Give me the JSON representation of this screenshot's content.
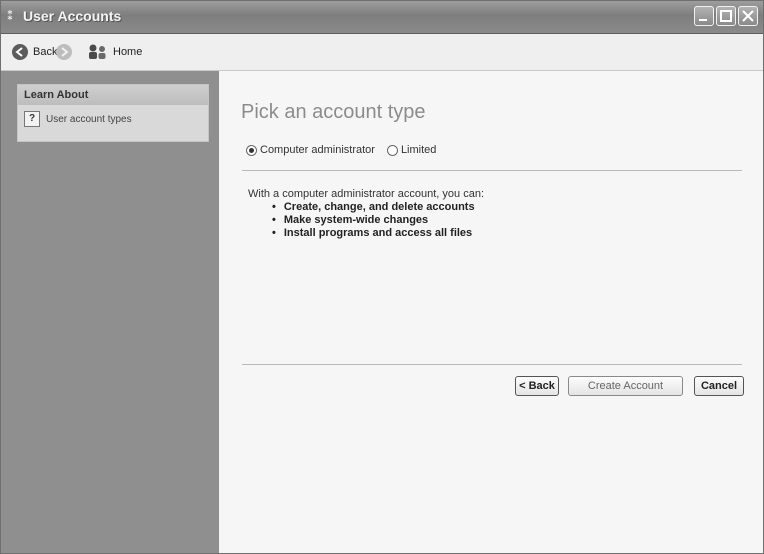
{
  "window": {
    "title": "User Accounts"
  },
  "toolbar": {
    "back_label": "Back",
    "home_label": "Home"
  },
  "sidebar": {
    "section_title": "Learn About",
    "items": [
      {
        "label": "User account types",
        "icon": "help-book-icon"
      }
    ]
  },
  "main": {
    "page_title": "Pick an account type",
    "account_types": [
      {
        "label": "Computer administrator",
        "selected": true
      },
      {
        "label": "Limited",
        "selected": false
      }
    ],
    "description": "With a computer administrator account, you can:",
    "capabilities": [
      "Create, change, and delete accounts",
      "Make system-wide changes",
      "Install programs and access all files"
    ],
    "buttons": {
      "back": "< Back",
      "create": "Create Account",
      "cancel": "Cancel"
    }
  }
}
